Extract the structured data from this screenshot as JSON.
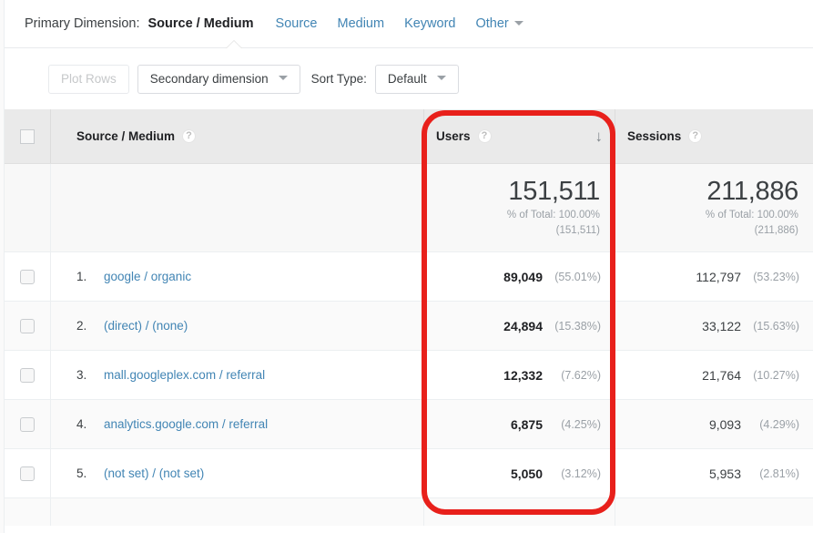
{
  "primary_dimension": {
    "label": "Primary Dimension:",
    "tabs": [
      {
        "label": "Source / Medium",
        "active": true
      },
      {
        "label": "Source",
        "active": false
      },
      {
        "label": "Medium",
        "active": false
      },
      {
        "label": "Keyword",
        "active": false
      },
      {
        "label": "Other",
        "active": false,
        "has_caret": true
      }
    ]
  },
  "toolbar": {
    "plot_rows_label": "Plot Rows",
    "secondary_dimension_label": "Secondary dimension",
    "sort_type_label": "Sort Type:",
    "sort_type_value": "Default"
  },
  "table": {
    "columns": [
      {
        "label": "Source / Medium",
        "help": "?"
      },
      {
        "label": "Users",
        "help": "?",
        "sorted": true,
        "sort_direction": "↓"
      },
      {
        "label": "Sessions",
        "help": "?"
      }
    ],
    "summary": {
      "users": {
        "value": "151,511",
        "pct_line": "% of Total: 100.00%",
        "total_line": "(151,511)"
      },
      "sessions": {
        "value": "211,886",
        "pct_line": "% of Total: 100.00%",
        "total_line": "(211,886)"
      }
    },
    "rows": [
      {
        "index": "1.",
        "dimension": "google / organic",
        "users": "89,049",
        "users_pct": "(55.01%)",
        "sessions": "112,797",
        "sessions_pct": "(53.23%)"
      },
      {
        "index": "2.",
        "dimension": "(direct) / (none)",
        "users": "24,894",
        "users_pct": "(15.38%)",
        "sessions": "33,122",
        "sessions_pct": "(15.63%)"
      },
      {
        "index": "3.",
        "dimension": "mall.googleplex.com / referral",
        "users": "12,332",
        "users_pct": "(7.62%)",
        "sessions": "21,764",
        "sessions_pct": "(10.27%)"
      },
      {
        "index": "4.",
        "dimension": "analytics.google.com / referral",
        "users": "6,875",
        "users_pct": "(4.25%)",
        "sessions": "9,093",
        "sessions_pct": "(4.29%)"
      },
      {
        "index": "5.",
        "dimension": "(not set) / (not set)",
        "users": "5,050",
        "users_pct": "(3.12%)",
        "sessions": "5,953",
        "sessions_pct": "(2.81%)"
      }
    ]
  },
  "annotation": {
    "color": "#e8201b",
    "target_column": "Users"
  }
}
